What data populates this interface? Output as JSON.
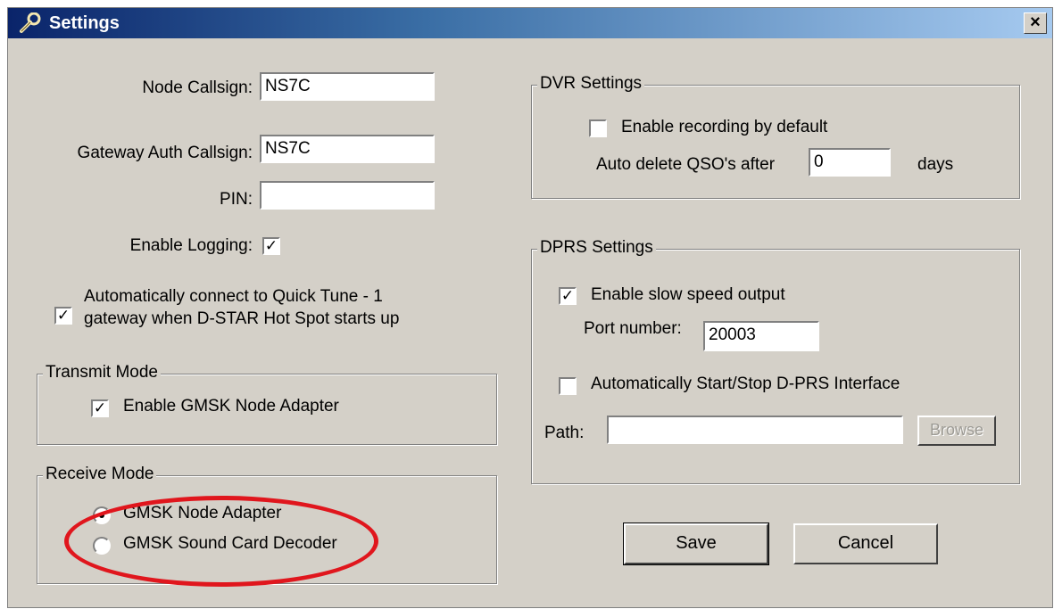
{
  "window": {
    "title": "Settings",
    "close_label": "×"
  },
  "node": {
    "callsign_label": "Node Callsign:",
    "callsign_value": "NS7C",
    "gateway_label": "Gateway Auth Callsign:",
    "gateway_value": "NS7C",
    "pin_label": "PIN:",
    "pin_value": "",
    "logging_label": "Enable Logging:",
    "logging_checked": true,
    "autoconnect_line1": "Automatically connect to Quick Tune - 1",
    "autoconnect_line2": "gateway when D-STAR Hot Spot starts up",
    "autoconnect_checked": true
  },
  "transmit": {
    "legend": "Transmit Mode",
    "gmsk_label": "Enable GMSK Node Adapter",
    "gmsk_checked": true
  },
  "receive": {
    "legend": "Receive Mode",
    "options": [
      "GMSK Node Adapter",
      "GMSK Sound Card Decoder"
    ],
    "selected": "GMSK Node Adapter"
  },
  "dvr": {
    "legend": "DVR Settings",
    "recording_label": "Enable recording by default",
    "recording_checked": false,
    "autodelete_label": "Auto delete QSO's after",
    "autodelete_value": "0",
    "days_label": "days"
  },
  "dprs": {
    "legend": "DPRS Settings",
    "slow_speed_label": "Enable slow speed output",
    "slow_speed_checked": true,
    "port_label": "Port number:",
    "port_value": "20003",
    "autostart_label": "Automatically Start/Stop D-PRS Interface",
    "autostart_checked": false,
    "path_label": "Path:",
    "path_value": "",
    "browse_label": "Browse"
  },
  "buttons": {
    "save": "Save",
    "cancel": "Cancel"
  },
  "colors": {
    "titlebar_start": "#0a246a",
    "annotation_circle": "#e0161d",
    "dialog_bg": "#d4d0c8"
  }
}
